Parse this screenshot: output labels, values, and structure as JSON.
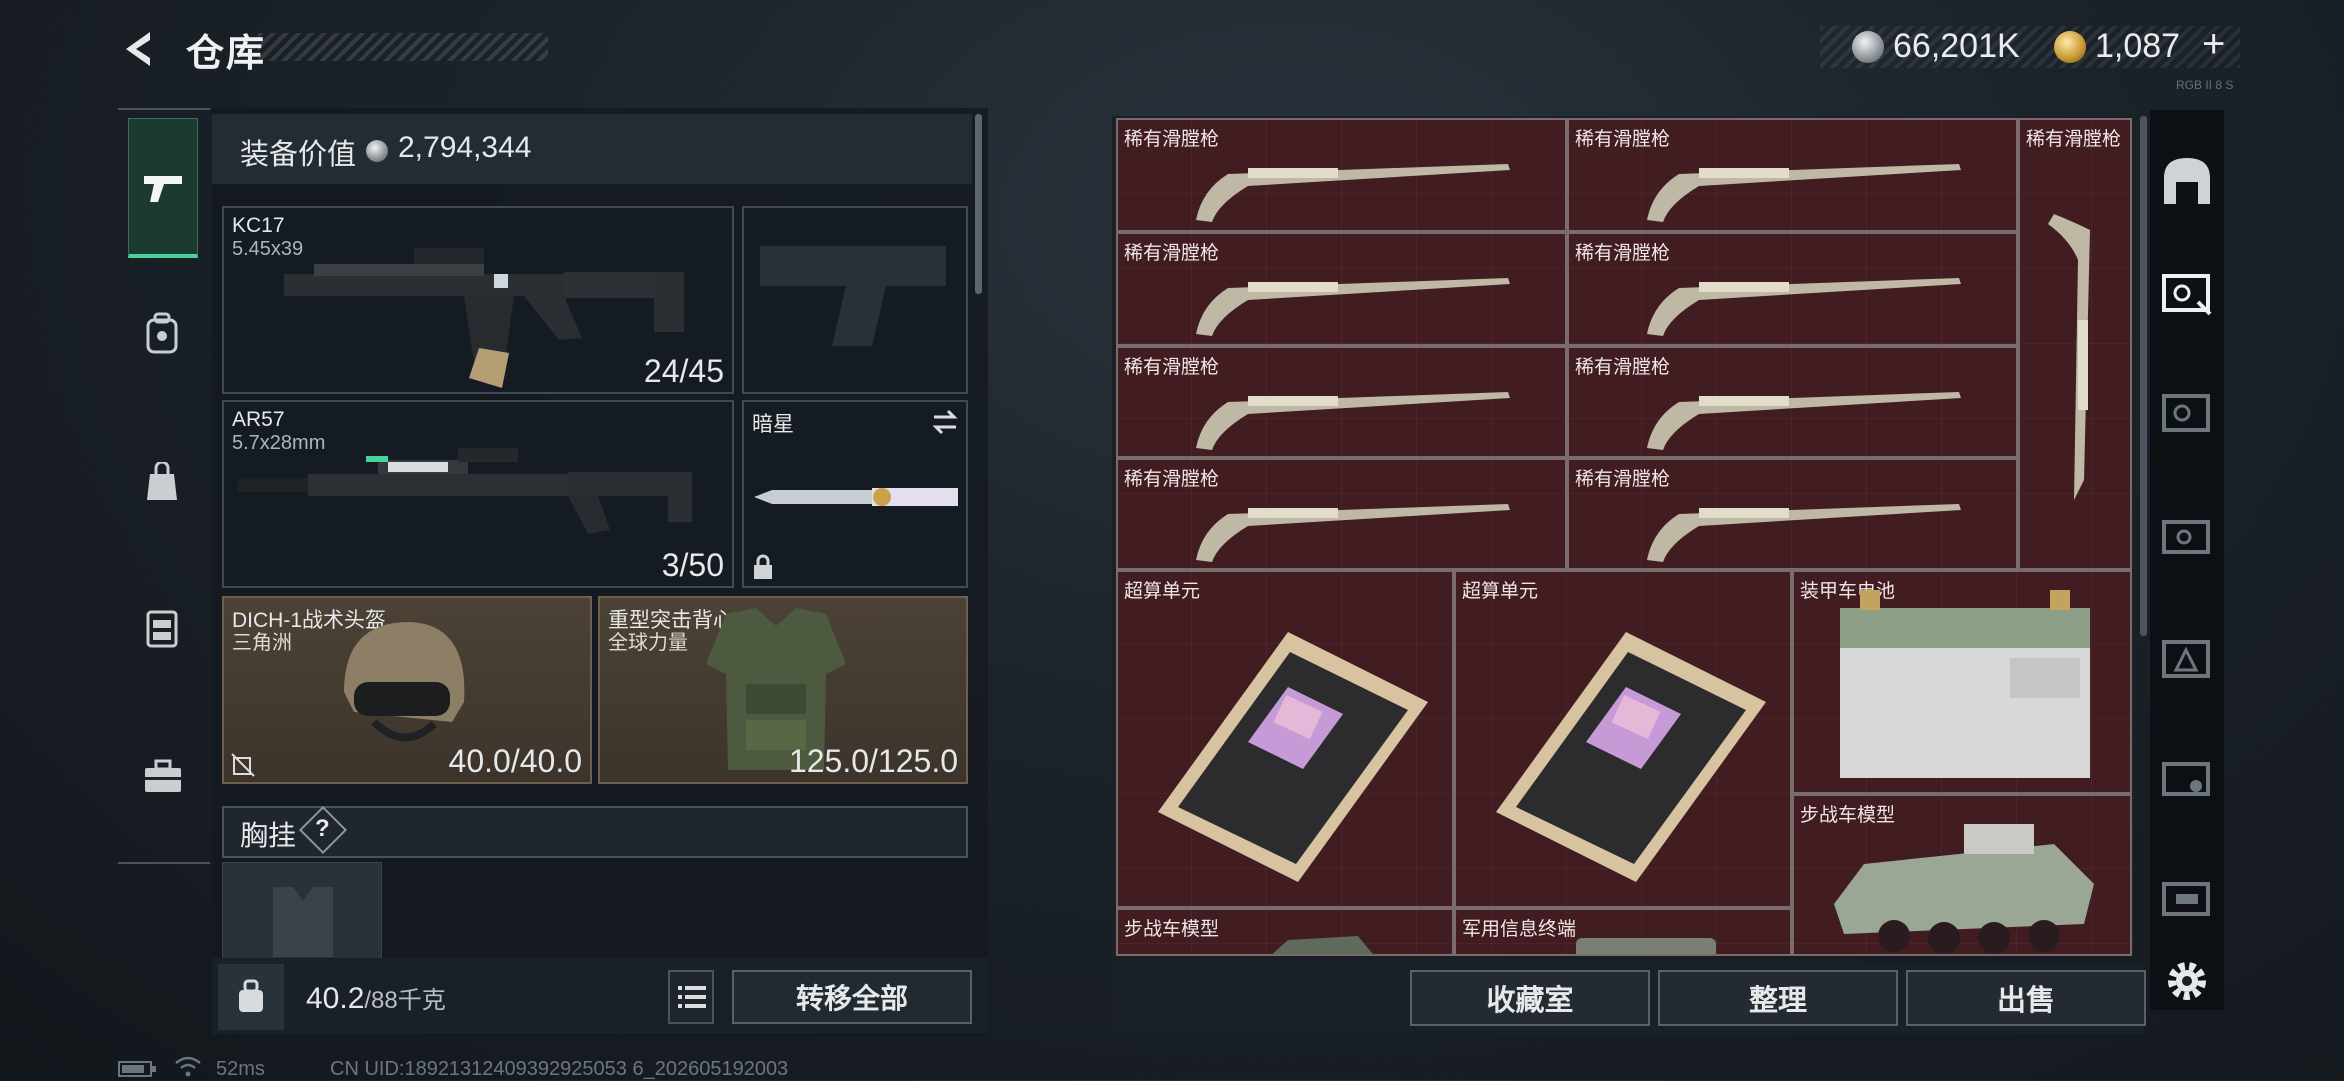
{
  "header": {
    "title": "仓库",
    "currency": [
      {
        "icon": "silver-coin-icon",
        "value": "66,201K"
      },
      {
        "icon": "gold-coin-icon",
        "value": "1,087"
      }
    ],
    "plus": "+",
    "signature": "RGB II 8 S"
  },
  "left_tabs": [
    "pistol-icon",
    "backpack-icon",
    "bag-icon",
    "vest-icon",
    "toolbox-icon"
  ],
  "equipment": {
    "value_label": "装备价值",
    "value": "2,794,344",
    "primary": {
      "name": "KC17",
      "caliber": "5.45x39",
      "ammo": "24/45"
    },
    "secondary": {
      "name": "AR57",
      "caliber": "5.7x28mm",
      "ammo": "3/50"
    },
    "melee": {
      "name": "暗星"
    },
    "helmet": {
      "name": "DICH-1战术头盔",
      "sub": "三角洲",
      "durability": "40.0/40.0"
    },
    "armor": {
      "name": "重型突击背心",
      "sub": "全球力量",
      "durability": "125.0/125.0"
    },
    "chest_label": "胸挂",
    "chest_help": "?",
    "weight": "40.2",
    "weight_unit": "/88千克",
    "transfer_all": "转移全部"
  },
  "grid": {
    "musket_label": "稀有滑膛枪",
    "compute_label": "超算单元",
    "battery_label": "装甲车电池",
    "ifv_label": "步战车模型",
    "terminal_label": "军用信息终端"
  },
  "bottom": {
    "collection": "收藏室",
    "organize": "整理",
    "sell": "出售"
  },
  "status": {
    "ping": "52ms",
    "uid": "CN UID:18921312409392925053 6_202605192003"
  },
  "colors": {
    "accent": "#48d39a",
    "grid_bg": "#3f1e22",
    "slot_brown": "#4c4236"
  }
}
